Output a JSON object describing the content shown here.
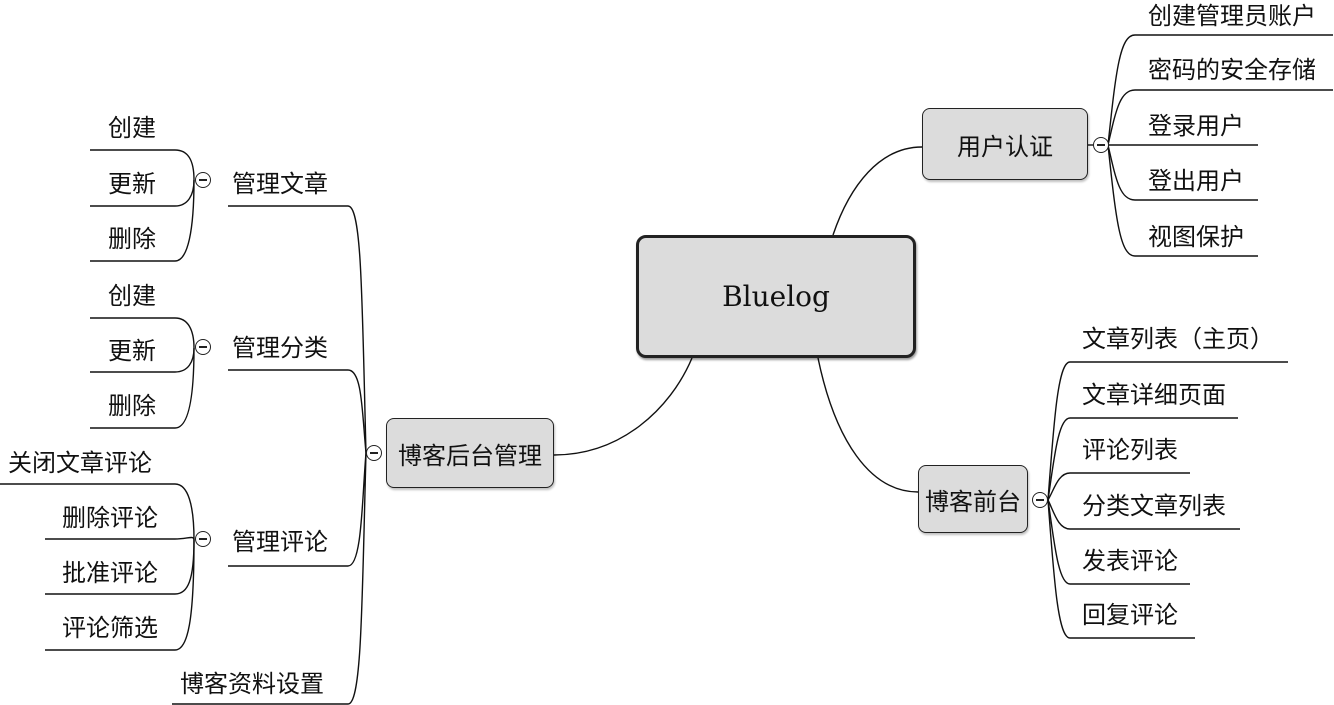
{
  "center": {
    "label": "Bluelog"
  },
  "auth": {
    "label": "用户认证",
    "items": [
      "创建管理员账户",
      "密码的安全存储",
      "登录用户",
      "登出用户",
      "视图保护"
    ]
  },
  "front": {
    "label": "博客前台",
    "items": [
      "文章列表（主页）",
      "文章详细页面",
      "评论列表",
      "分类文章列表",
      "发表评论",
      "回复评论"
    ]
  },
  "admin": {
    "label": "博客后台管理",
    "posts": {
      "label": "管理文章",
      "items": [
        "创建",
        "更新",
        "删除"
      ]
    },
    "categories": {
      "label": "管理分类",
      "items": [
        "创建",
        "更新",
        "删除"
      ]
    },
    "comments": {
      "label": "管理评论",
      "items": [
        "关闭文章评论",
        "删除评论",
        "批准评论",
        "评论筛选"
      ]
    },
    "settings": {
      "label": "博客资料设置"
    }
  },
  "icons": {
    "collapse": "collapse-minus-icon"
  }
}
